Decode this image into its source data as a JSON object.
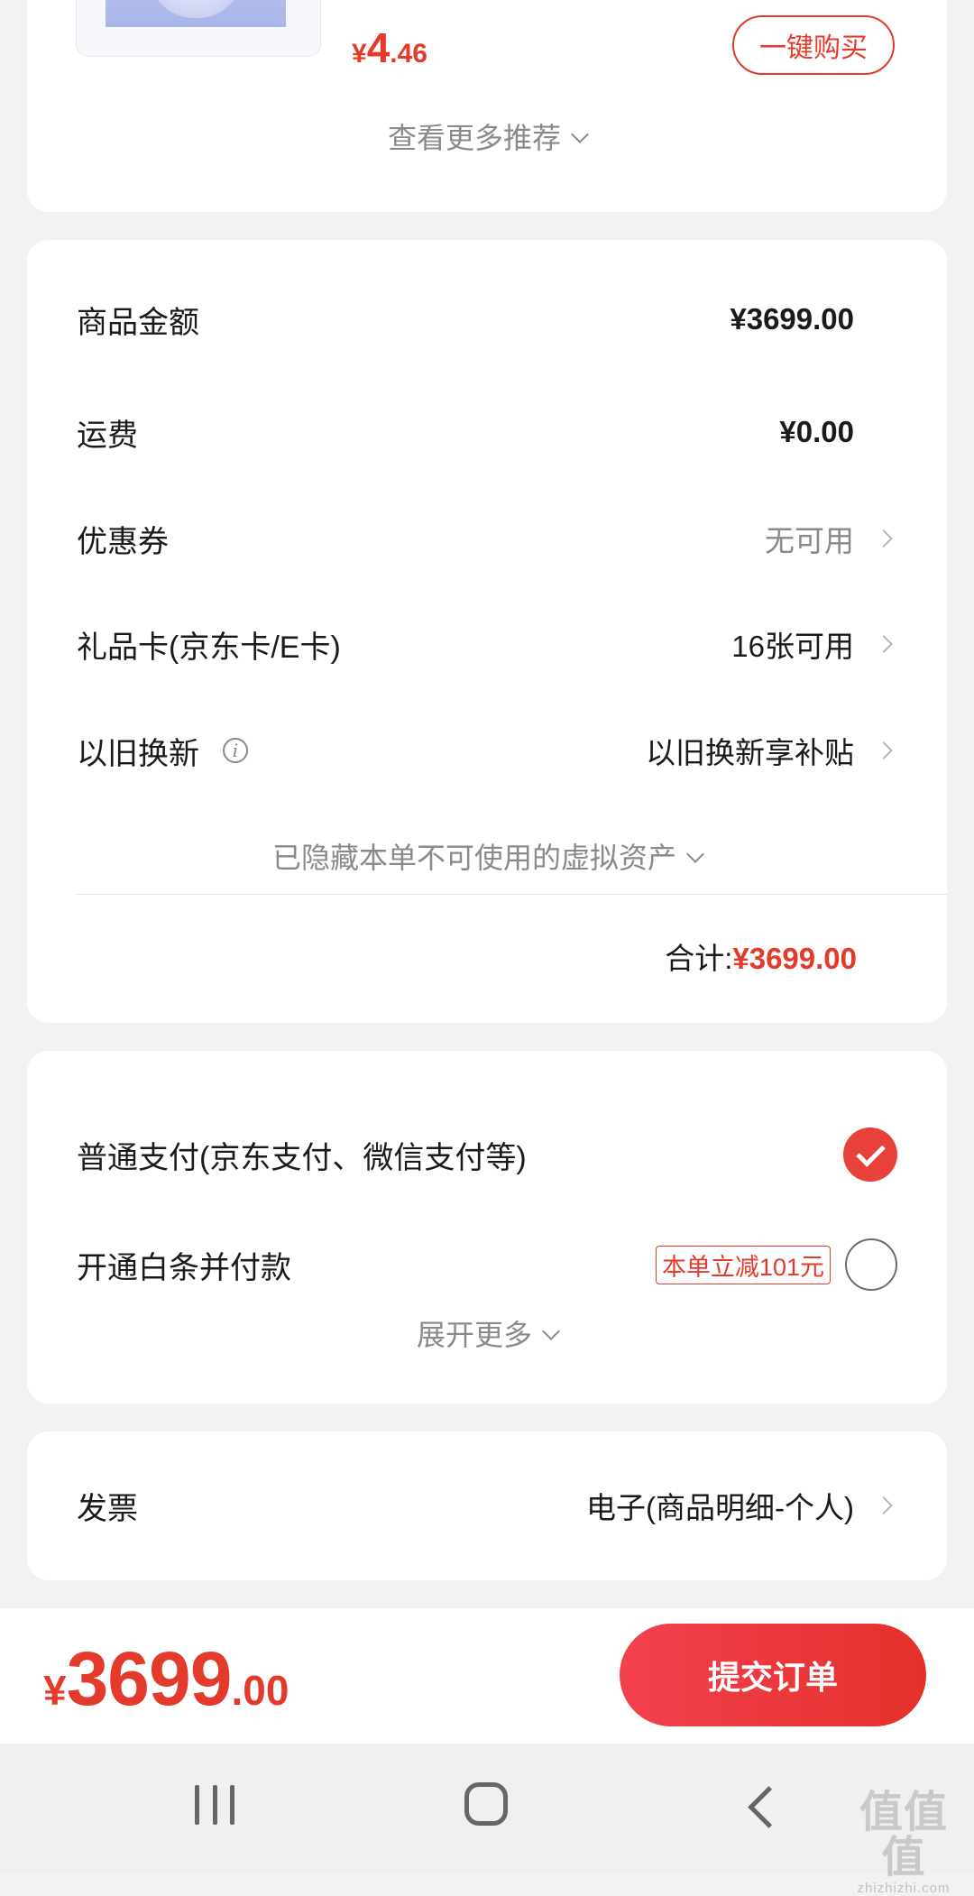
{
  "recommendation": {
    "price_currency": "¥",
    "price_int": "4",
    "price_dec": ".46",
    "buy_label": "一键购买",
    "see_more_label": "查看更多推荐"
  },
  "price_breakdown": {
    "goods_amount": {
      "label": "商品金额",
      "value": "¥3699.00"
    },
    "shipping": {
      "label": "运费",
      "value": "¥0.00"
    },
    "coupon": {
      "label": "优惠券",
      "value": "无可用"
    },
    "gift_card": {
      "label": "礼品卡(京东卡/E卡)",
      "value": "16张可用"
    },
    "trade_in": {
      "label": "以旧换新",
      "value": "以旧换新享补贴"
    },
    "hidden_assets_label": "已隐藏本单不可使用的虚拟资产",
    "total_label": "合计:",
    "total_value": "¥3699.00"
  },
  "payment": {
    "options": [
      {
        "label": "普通支付(京东支付、微信支付等)",
        "selected": true
      },
      {
        "label": "开通白条并付款",
        "promo": "本单立减101元",
        "selected": false
      }
    ],
    "expand_label": "展开更多"
  },
  "invoice": {
    "label": "发票",
    "value": "电子(商品明细-个人)"
  },
  "bottom_bar": {
    "currency": "¥",
    "price_int": "3699",
    "price_dec": ".00",
    "submit_label": "提交订单"
  },
  "watermark": {
    "main": "值值值",
    "sub": "zhizhizhi.com"
  },
  "colors": {
    "accent": "#e33a2c",
    "background": "#f2f2f2"
  }
}
